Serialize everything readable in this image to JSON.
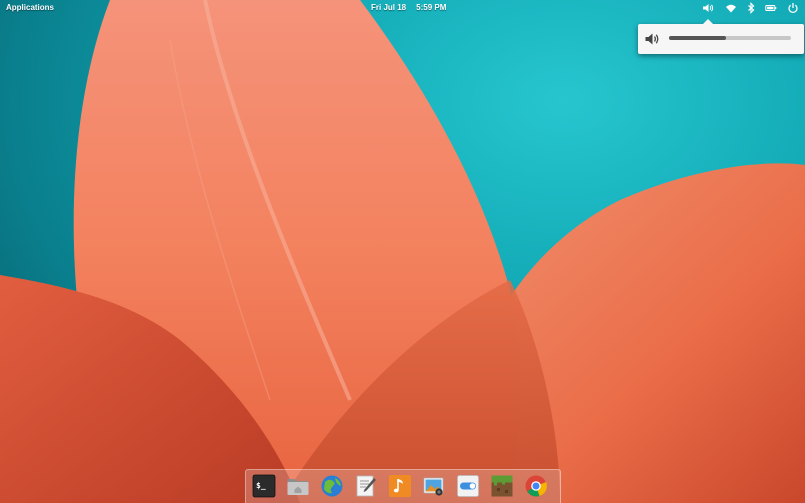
{
  "panel": {
    "applications_label": "Applications",
    "clock_date": "Fri Jul 18",
    "clock_time": "5:59 PM",
    "indicators": [
      "speaker-icon",
      "wifi-icon",
      "bluetooth-icon",
      "battery-icon",
      "power-icon"
    ]
  },
  "sound_popover": {
    "volume_percent": 47,
    "icon": "speaker-icon"
  },
  "dock": {
    "items": [
      {
        "name": "terminal",
        "glyph": "$_"
      },
      {
        "name": "files"
      },
      {
        "name": "web-browser"
      },
      {
        "name": "text-editor"
      },
      {
        "name": "music"
      },
      {
        "name": "photos"
      },
      {
        "name": "settings"
      },
      {
        "name": "minecraft"
      },
      {
        "name": "chrome"
      }
    ]
  },
  "colors": {
    "sky": "#11a9b5",
    "petal": "#f07a55",
    "petal_dark": "#d9583a",
    "panel_text": "#ffffff"
  }
}
